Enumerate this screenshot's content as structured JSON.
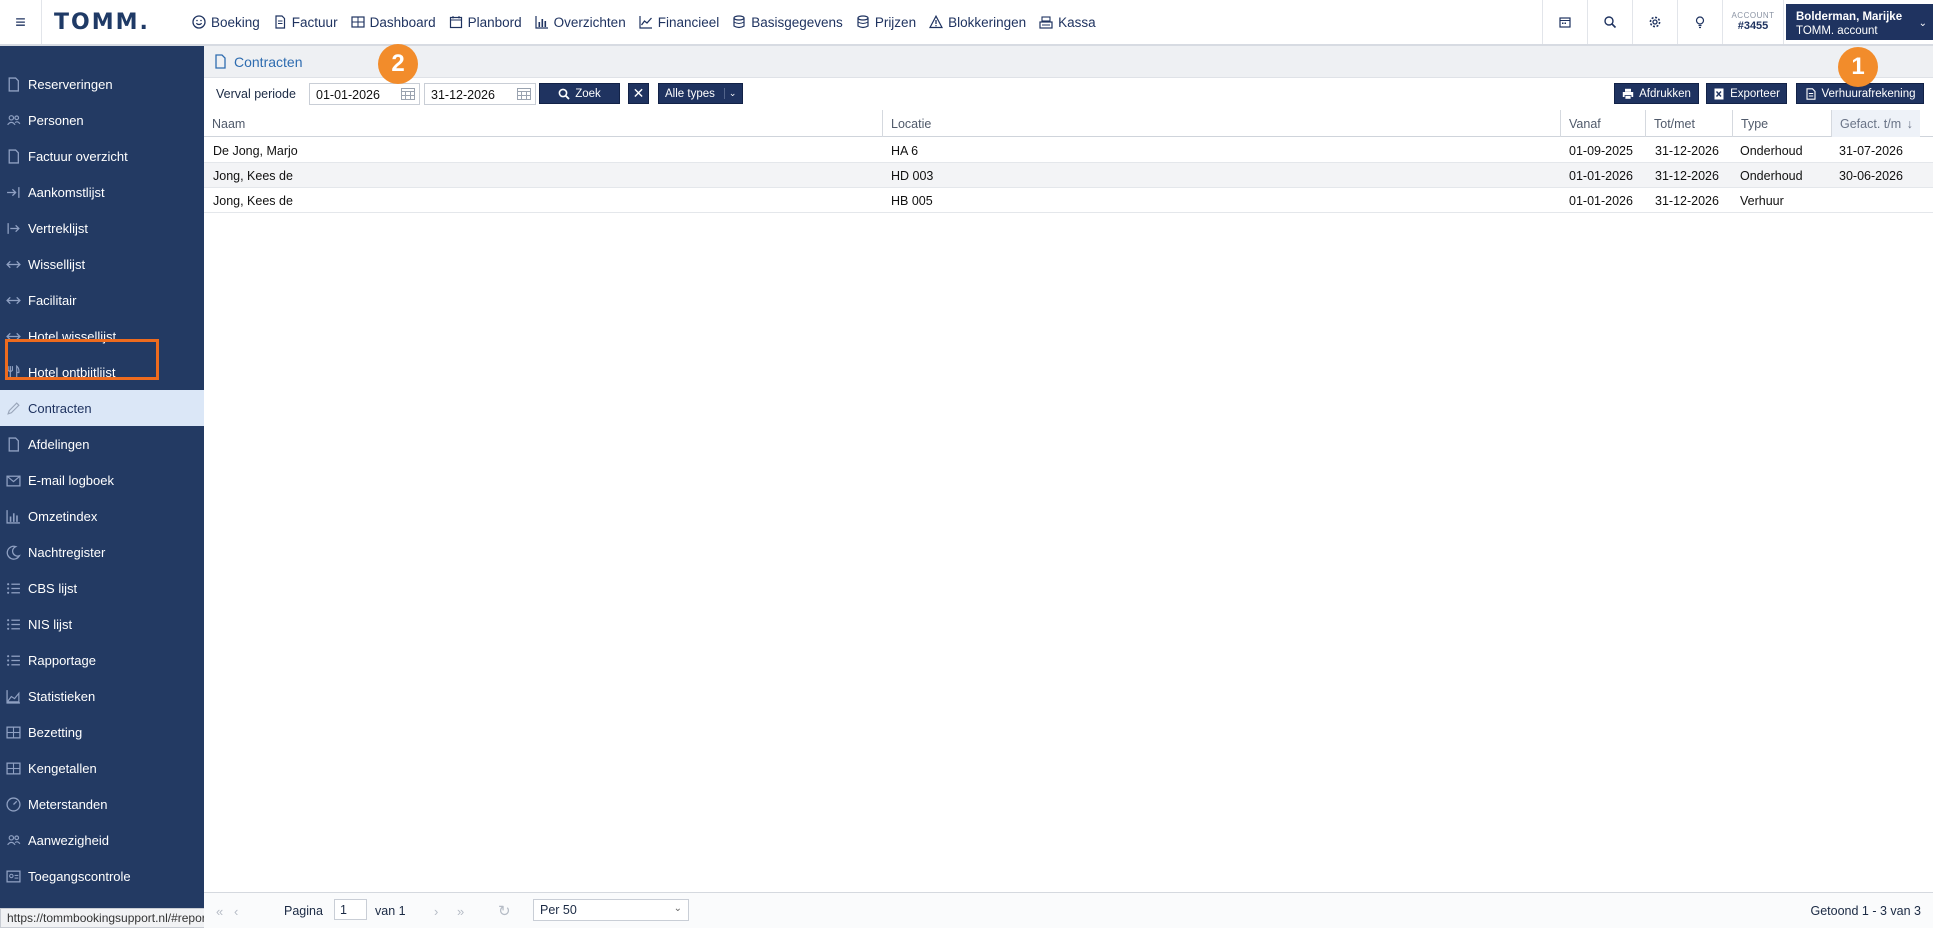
{
  "app": {
    "logo": "TOMM.",
    "status_url": "https://tommbookingsupport.nl/#report/contract"
  },
  "topnav": {
    "items": [
      {
        "label": "Boeking",
        "icon": "smiley-icon"
      },
      {
        "label": "Factuur",
        "icon": "document-icon"
      },
      {
        "label": "Dashboard",
        "icon": "dashboard-grid-icon"
      },
      {
        "label": "Planbord",
        "icon": "calendar-icon"
      },
      {
        "label": "Overzichten",
        "icon": "bar-chart-icon"
      },
      {
        "label": "Financieel",
        "icon": "line-chart-icon"
      },
      {
        "label": "Basisgegevens",
        "icon": "database-icon"
      },
      {
        "label": "Prijzen",
        "icon": "database-icon"
      },
      {
        "label": "Blokkeringen",
        "icon": "warning-icon"
      },
      {
        "label": "Kassa",
        "icon": "cash-register-icon"
      }
    ],
    "account_label": "ACCOUNT",
    "account_number": "#3455",
    "user_name": "Bolderman, Marijke",
    "user_sub": "TOMM. account"
  },
  "sidebar": {
    "items": [
      {
        "label": "Reserveringen",
        "icon": "document-icon"
      },
      {
        "label": "Personen",
        "icon": "people-icon"
      },
      {
        "label": "Factuur overzicht",
        "icon": "document-icon"
      },
      {
        "label": "Aankomstlijst",
        "icon": "arrive-icon"
      },
      {
        "label": "Vertreklijst",
        "icon": "depart-icon"
      },
      {
        "label": "Wissellijst",
        "icon": "swap-icon"
      },
      {
        "label": "Facilitair",
        "icon": "swap-icon"
      },
      {
        "label": "Hotel wissellijst",
        "icon": "swap-icon"
      },
      {
        "label": "Hotel ontbijtlijst",
        "icon": "cutlery-icon"
      },
      {
        "label": "Contracten",
        "icon": "pen-icon",
        "active": true
      },
      {
        "label": "Afdelingen",
        "icon": "document-icon"
      },
      {
        "label": "E-mail logboek",
        "icon": "envelope-icon"
      },
      {
        "label": "Omzetindex",
        "icon": "bar-chart-icon"
      },
      {
        "label": "Nachtregister",
        "icon": "moon-icon"
      },
      {
        "label": "CBS lijst",
        "icon": "list-icon"
      },
      {
        "label": "NIS lijst",
        "icon": "list-icon"
      },
      {
        "label": "Rapportage",
        "icon": "list-icon"
      },
      {
        "label": "Statistieken",
        "icon": "area-chart-icon"
      },
      {
        "label": "Bezetting",
        "icon": "grid-icon"
      },
      {
        "label": "Kengetallen",
        "icon": "grid-icon"
      },
      {
        "label": "Meterstanden",
        "icon": "gauge-icon"
      },
      {
        "label": "Aanwezigheid",
        "icon": "people-icon"
      },
      {
        "label": "Toegangscontrole",
        "icon": "id-card-icon"
      }
    ]
  },
  "page": {
    "title": "Contracten"
  },
  "filters": {
    "period_label": "Verval periode",
    "date_from": "01-01-2026",
    "date_to": "31-12-2026",
    "search_label": "Zoek",
    "type_select": "Alle types"
  },
  "actions": {
    "print_label": "Afdrukken",
    "export_label": "Exporteer",
    "settlement_label": "Verhuurafrekening"
  },
  "annotations": {
    "badge_1": "1",
    "badge_2": "2"
  },
  "table": {
    "columns": [
      "Naam",
      "Locatie",
      "Vanaf",
      "Tot/met",
      "Type",
      "Gefact. t/m"
    ],
    "sort_icon": "arrow-down-icon",
    "rows": [
      [
        "De Jong, Marjo",
        "HA 6",
        "01-09-2025",
        "31-12-2026",
        "Onderhoud",
        "31-07-2026"
      ],
      [
        "Jong, Kees de",
        "HD 003",
        "01-01-2026",
        "31-12-2026",
        "Onderhoud",
        "30-06-2026"
      ],
      [
        "Jong, Kees de",
        "HB 005",
        "01-01-2026",
        "31-12-2026",
        "Verhuur",
        ""
      ]
    ]
  },
  "pager": {
    "page_label": "Pagina",
    "page_value": "1",
    "of_label": "van 1",
    "per_page": "Per 50",
    "summary": "Getoond 1 - 3 van 3"
  },
  "colors": {
    "sidebar_bg": "#233a63",
    "accent": "#1f3360",
    "active_item_bg": "#dbe7f7",
    "badge": "#f28c2b",
    "highlight_border": "#ee6b1e",
    "title_link": "#2e6cb0"
  }
}
